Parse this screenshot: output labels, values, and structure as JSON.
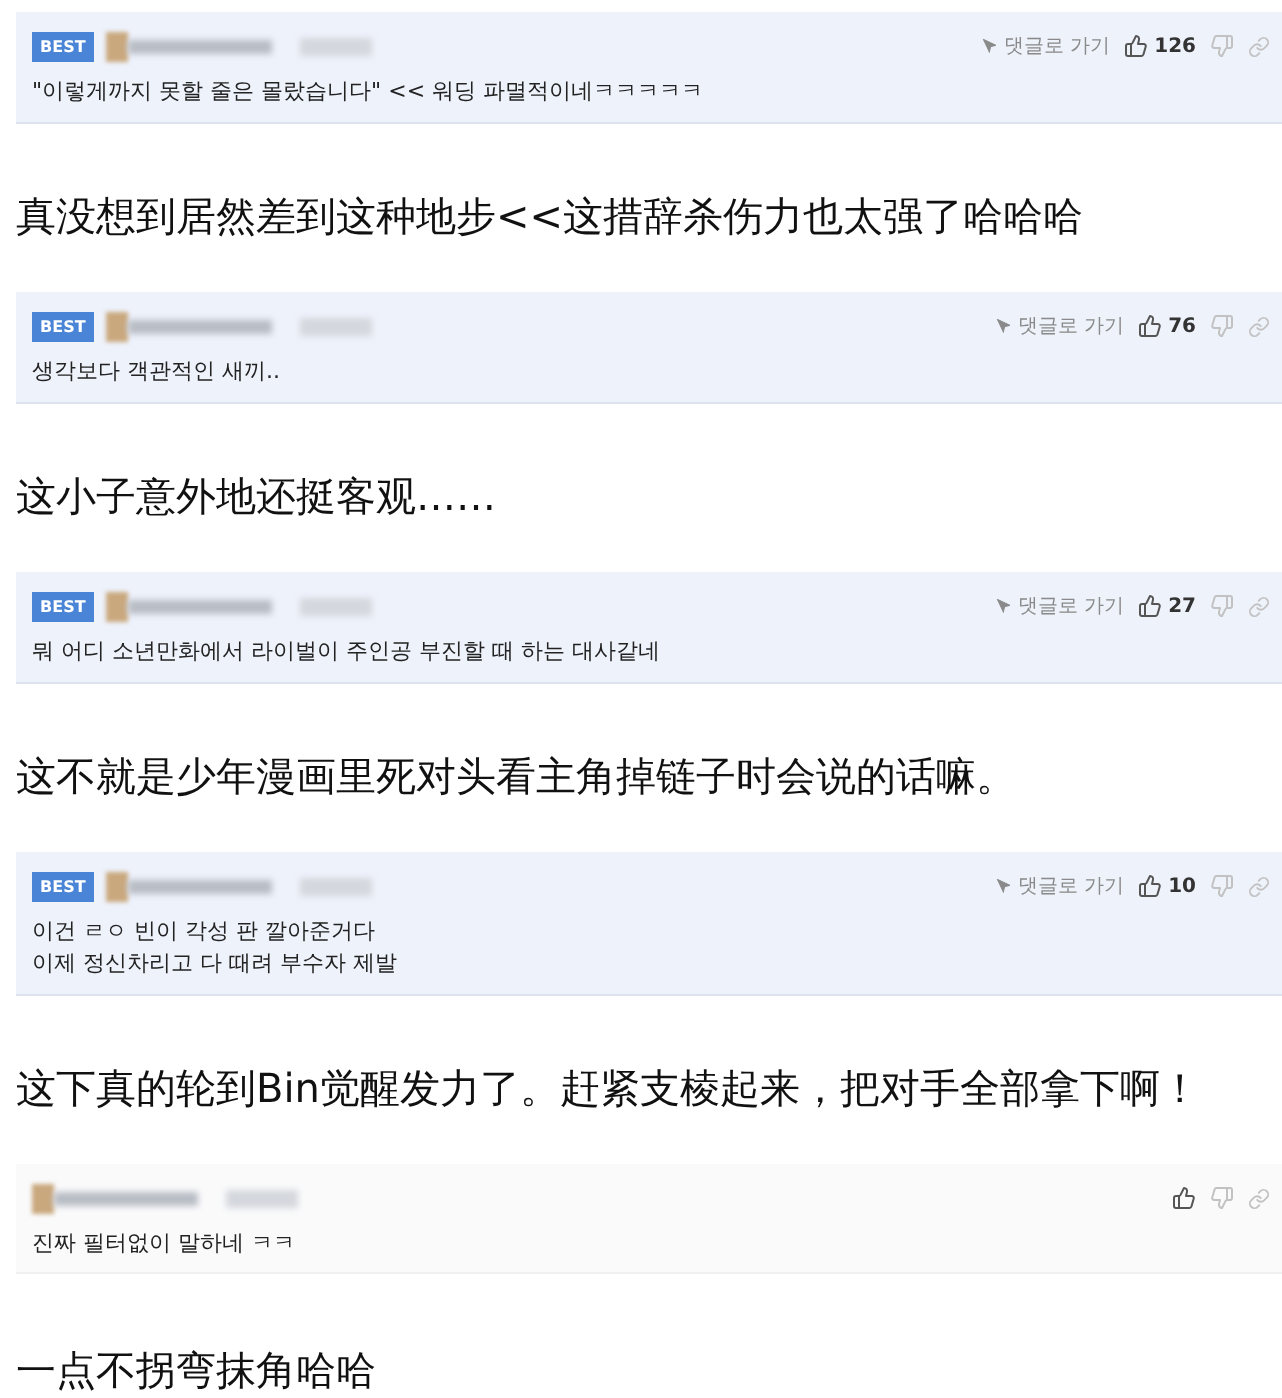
{
  "comments": [
    {
      "best": true,
      "badge": "BEST",
      "reply_link": "댓글로 가기",
      "likes": "126",
      "text": "\"이렇게까지 못할 줄은 몰랐습니다\" << 워딩 파멸적이네ㅋㅋㅋㅋㅋ",
      "translation": "真没想到居然差到这种地步<<这措辞杀伤力也太强了哈哈哈"
    },
    {
      "best": true,
      "badge": "BEST",
      "reply_link": "댓글로 가기",
      "likes": "76",
      "text": "생각보다 객관적인 새끼..",
      "translation": "这小子意外地还挺客观……"
    },
    {
      "best": true,
      "badge": "BEST",
      "reply_link": "댓글로 가기",
      "likes": "27",
      "text": "뭐 어디 소년만화에서 라이벌이 주인공 부진할 때 하는 대사같네",
      "translation": "这不就是少年漫画里死对头看主角掉链子时会说的话嘛。"
    },
    {
      "best": true,
      "badge": "BEST",
      "reply_link": "댓글로 가기",
      "likes": "10",
      "text": "이건 ㄹㅇ 빈이 각성 판 깔아준거다\n이제 정신차리고 다 때려 부수자 제발",
      "translation": "这下真的轮到Bin觉醒发力了。赶紧支棱起来，把对手全部拿下啊！"
    },
    {
      "best": false,
      "text": "진짜 필터없이 말하네 ㅋㅋ",
      "translation": "一点不拐弯抹角哈哈"
    }
  ]
}
